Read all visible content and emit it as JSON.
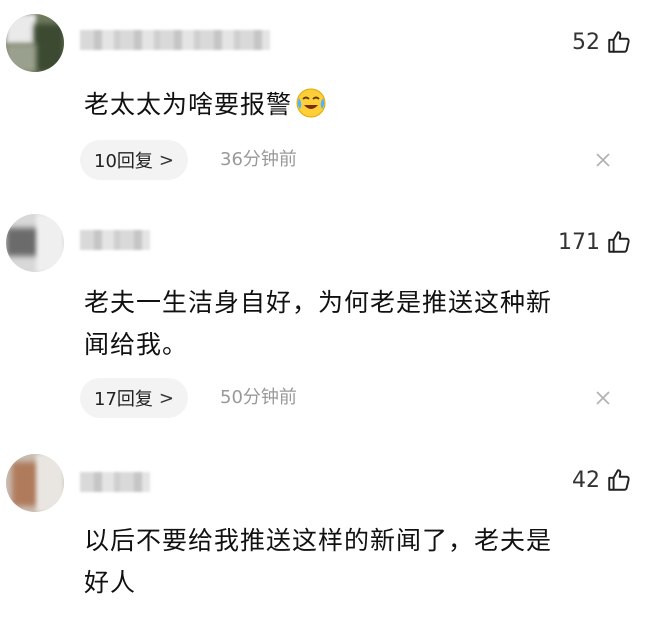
{
  "comments": [
    {
      "likes": "52",
      "text": "老太太为啥要报警",
      "emoji": "crying-laughing-face",
      "reply_label": "10回复",
      "time": "36分钟前"
    },
    {
      "likes": "171",
      "text_line1": "老夫一生洁身自好，为何老是推送这种新",
      "text_line2": "闻给我。",
      "reply_label": "17回复",
      "time": "50分钟前"
    },
    {
      "likes": "42",
      "text_line1": "以后不要给我推送这样的新闻了，老夫是",
      "text_line2": "好人"
    }
  ],
  "icons": {
    "like": "thumb-up-icon",
    "reply_chevron": ">",
    "close": "close-icon"
  }
}
